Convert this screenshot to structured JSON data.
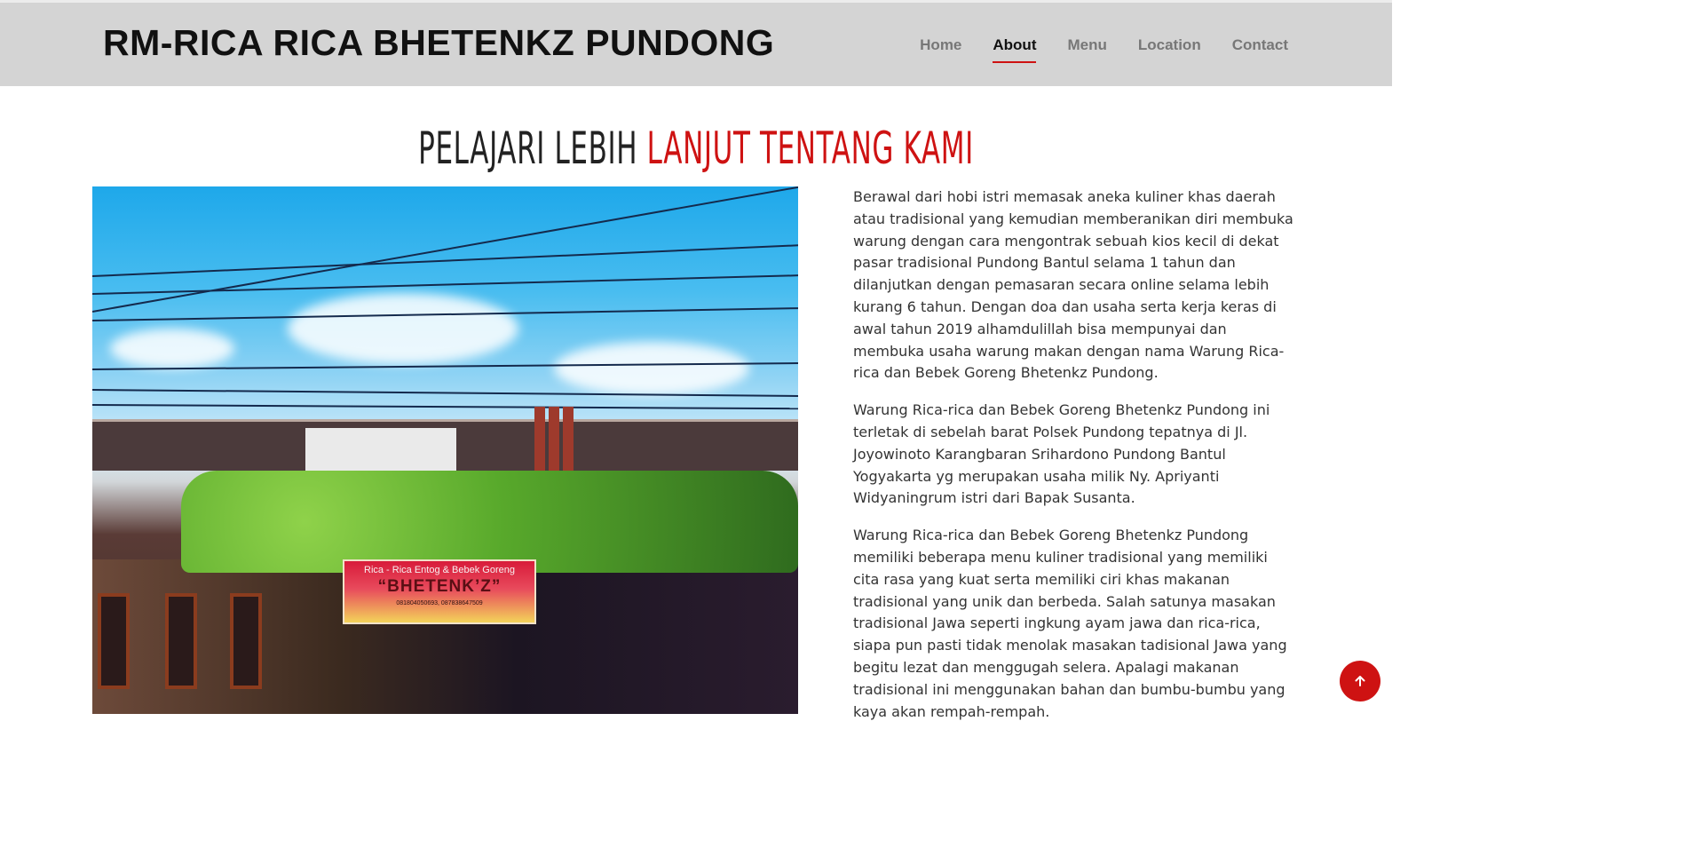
{
  "header": {
    "brand": "RM-RICA RICA BHETENKZ PUNDONG",
    "nav": [
      {
        "label": "Home",
        "active": false
      },
      {
        "label": "About",
        "active": true
      },
      {
        "label": "Menu",
        "active": false
      },
      {
        "label": "Location",
        "active": false
      },
      {
        "label": "Contact",
        "active": false
      }
    ]
  },
  "section": {
    "title_main": "PELAJARI LEBIH ",
    "title_accent": "LANJUT TENTANG KAMI"
  },
  "photo": {
    "sign_line1": "Rica - Rica Entog & Bebek Goreng",
    "sign_line2": "“BHETENK’Z”",
    "sign_line3": "081804050693, 087838647509"
  },
  "paragraphs": [
    "Berawal dari hobi istri memasak aneka kuliner khas daerah atau tradisional yang kemudian memberanikan diri membuka warung dengan cara mengontrak sebuah kios kecil di dekat pasar tradisional Pundong Bantul selama 1 tahun dan dilanjutkan dengan pemasaran secara online selama lebih kurang 6 tahun. Dengan doa dan usaha serta kerja keras di awal tahun 2019 alhamdulillah bisa mempunyai dan membuka usaha warung makan dengan nama Warung Rica-rica dan Bebek Goreng Bhetenkz Pundong.",
    "Warung Rica-rica dan Bebek Goreng Bhetenkz Pundong ini terletak di sebelah barat Polsek Pundong tepatnya di Jl. Joyowinoto Karangbaran Srihardono Pundong Bantul Yogyakarta yg merupakan usaha milik Ny. Apriyanti Widyaningrum istri dari Bapak Susanta.",
    "Warung Rica-rica dan Bebek Goreng Bhetenkz Pundong memiliki beberapa menu kuliner tradisional yang memiliki cita rasa yang kuat serta memiliki ciri khas makanan tradisional yang unik dan berbeda. Salah satunya masakan tradisional Jawa seperti ingkung ayam jawa dan rica-rica, siapa pun pasti tidak menolak masakan tadisional Jawa yang begitu lezat dan menggugah selera. Apalagi makanan tradisional ini menggunakan bahan dan bumbu-bumbu yang kaya akan rempah-rempah."
  ],
  "icons": {
    "back_to_top": "arrow-up-icon"
  },
  "colors": {
    "accent": "#ce1212",
    "header_bg": "#d4d4d4"
  }
}
